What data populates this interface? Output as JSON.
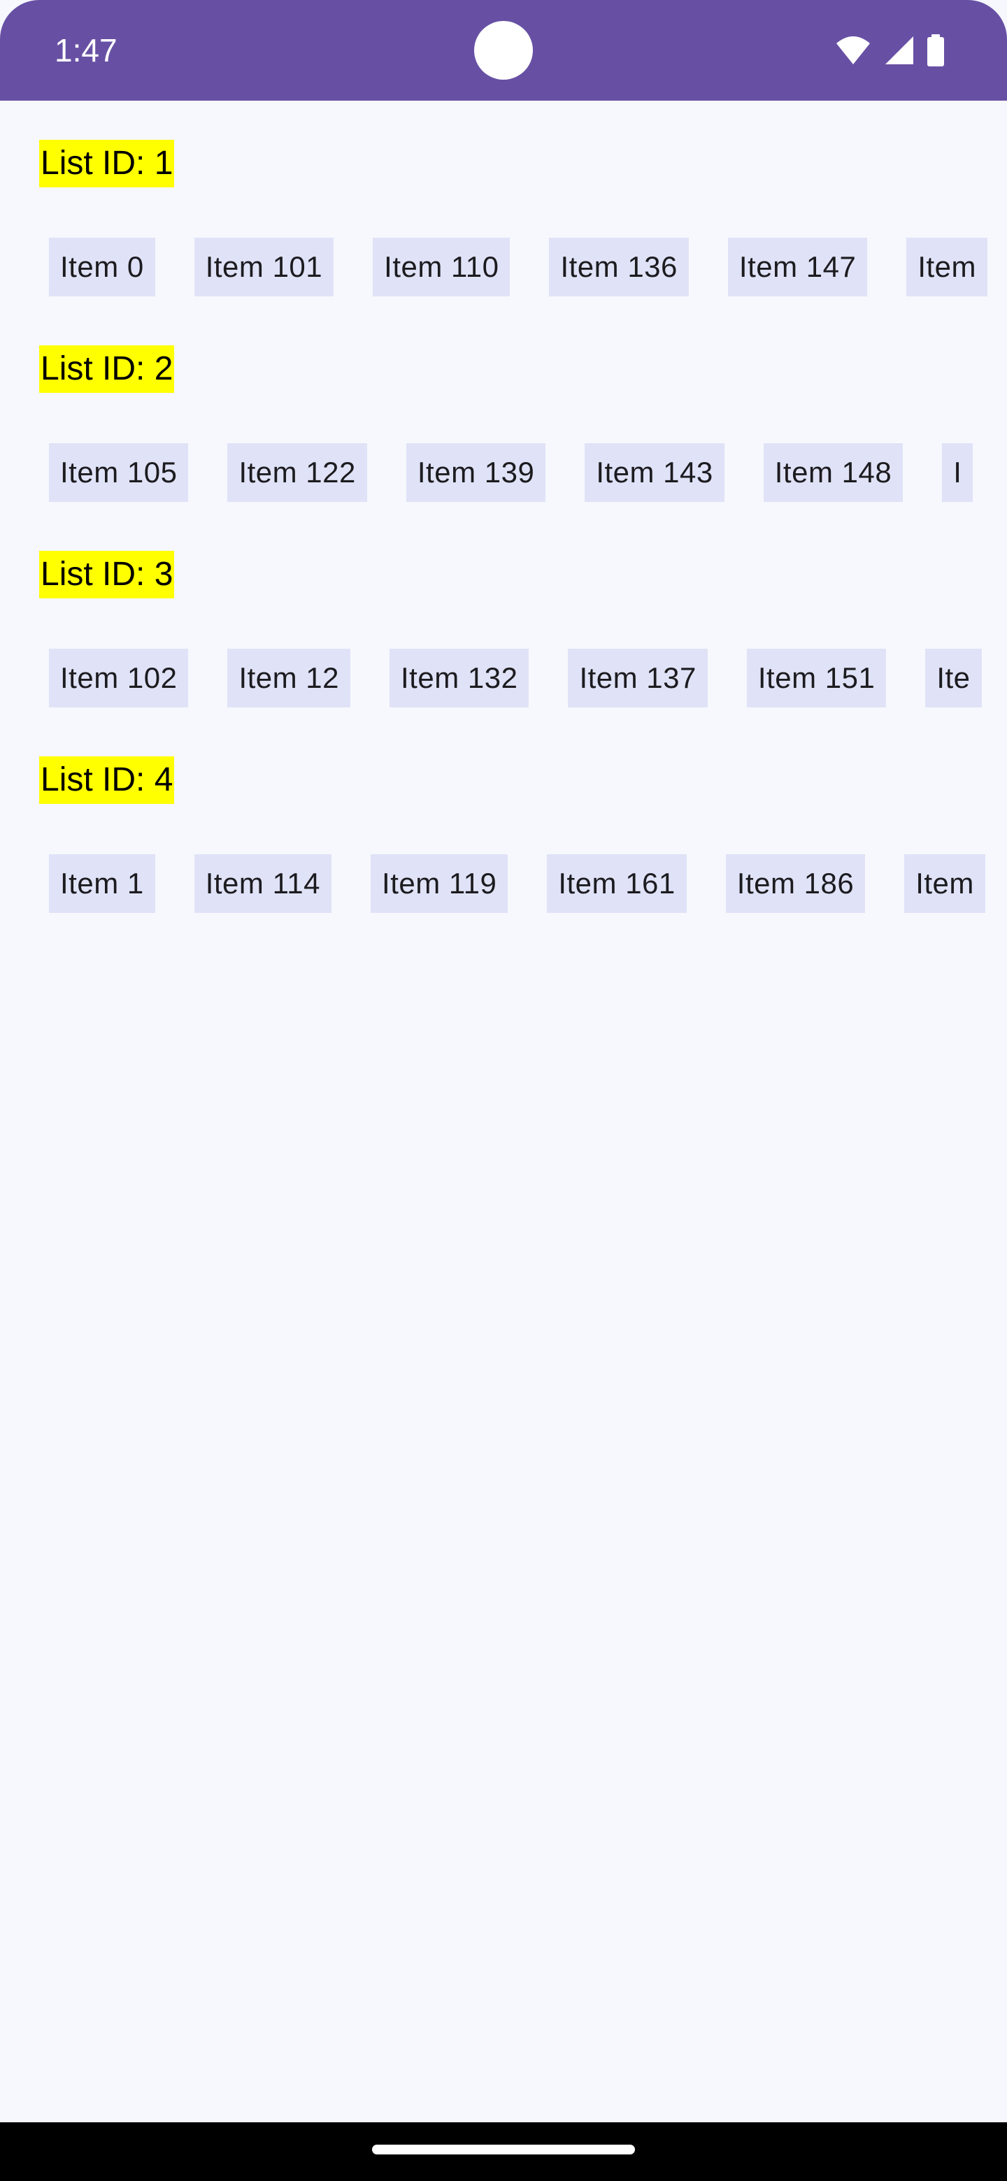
{
  "status_bar": {
    "time": "1:47",
    "icons": [
      "wifi-icon",
      "signal-icon",
      "battery-icon"
    ],
    "color": "#6750A4"
  },
  "colors": {
    "background": "#F6F8FD",
    "label_highlight": "#FFFF00",
    "chip_background": "#E0E3F7"
  },
  "lists": [
    {
      "label": "List ID: 1",
      "items": [
        "Item 0",
        "Item 101",
        "Item 110",
        "Item 136",
        "Item 147",
        "Item"
      ]
    },
    {
      "label": "List ID: 2",
      "items": [
        "Item 105",
        "Item 122",
        "Item 139",
        "Item 143",
        "Item 148",
        "I"
      ]
    },
    {
      "label": "List ID: 3",
      "items": [
        "Item 102",
        "Item 12",
        "Item 132",
        "Item 137",
        "Item 151",
        "Ite"
      ]
    },
    {
      "label": "List ID: 4",
      "items": [
        "Item 1",
        "Item 114",
        "Item 119",
        "Item 161",
        "Item 186",
        "Item"
      ]
    }
  ]
}
